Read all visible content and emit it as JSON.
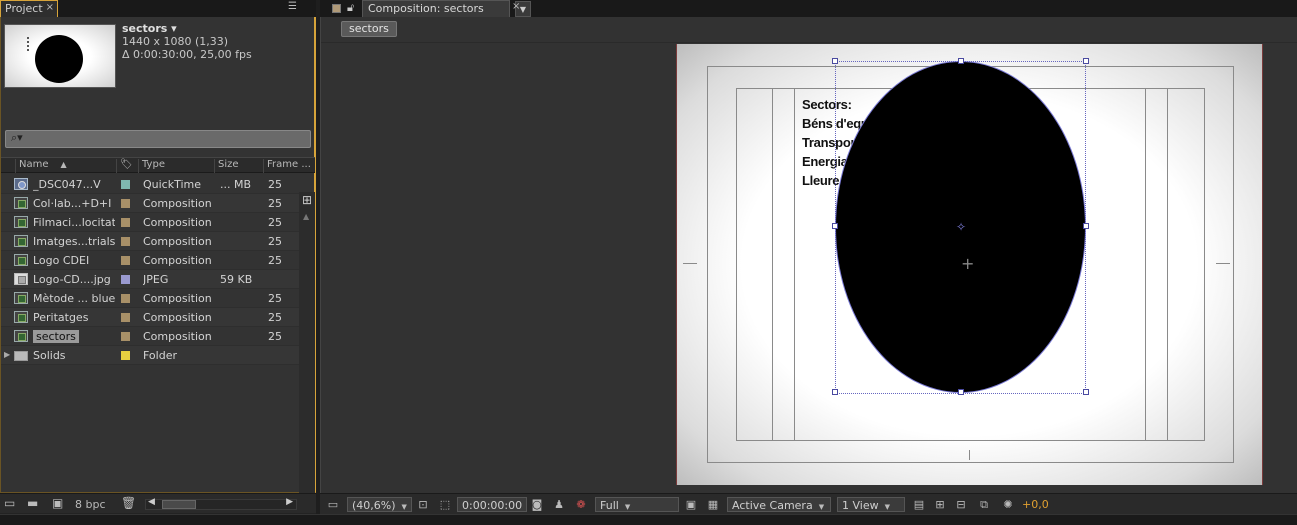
{
  "project_panel": {
    "tab_label": "Project",
    "close_glyph": "×",
    "menu_glyph": "☰",
    "selected_item": {
      "name": "sectors ▾",
      "dimensions": "1440 x 1080 (1,33)",
      "duration": "Δ 0:00:30:00, 25,00 fps"
    },
    "search_placeholder": "",
    "search_icon": "⌕▾",
    "columns": {
      "name": "Name",
      "label": "",
      "type": "Type",
      "size": "Size",
      "frame": "Frame ..."
    },
    "items": [
      {
        "icon": "quicktime",
        "name": "_DSC047...V",
        "label_color": "#7fb8b0",
        "type": "QuickTime",
        "size": "... MB",
        "frame": "25"
      },
      {
        "icon": "composition",
        "name": "Col·lab...+D+I",
        "label_color": "#a89068",
        "type": "Composition",
        "size": "",
        "frame": "25"
      },
      {
        "icon": "composition",
        "name": "Filmaci...locitat",
        "label_color": "#a89068",
        "type": "Composition",
        "size": "",
        "frame": "25"
      },
      {
        "icon": "composition",
        "name": "Imatges...trials",
        "label_color": "#a89068",
        "type": "Composition",
        "size": "",
        "frame": "25"
      },
      {
        "icon": "composition",
        "name": "Logo CDEI",
        "label_color": "#a89068",
        "type": "Composition",
        "size": "",
        "frame": "25"
      },
      {
        "icon": "jpeg",
        "name": "Logo-CD....jpg",
        "label_color": "#9a9ad0",
        "type": "JPEG",
        "size": "59 KB",
        "frame": ""
      },
      {
        "icon": "composition",
        "name": "Mètode ... blue",
        "label_color": "#a89068",
        "type": "Composition",
        "size": "",
        "frame": "25"
      },
      {
        "icon": "composition",
        "name": "Peritatges",
        "label_color": "#a89068",
        "type": "Composition",
        "size": "",
        "frame": "25"
      },
      {
        "icon": "composition",
        "name": "sectors",
        "label_color": "#a89068",
        "type": "Composition",
        "size": "",
        "frame": "25"
      },
      {
        "icon": "folder",
        "name": "Solids",
        "label_color": "#e8d040",
        "type": "Folder",
        "size": "",
        "frame": ""
      }
    ],
    "footer": {
      "bpc": "8 bpc"
    }
  },
  "composition_panel": {
    "tab_label": "Composition: sectors",
    "breadcrumb": "sectors",
    "canvas_text": [
      "Sectors:",
      "Béns d'equ",
      "Transport",
      "Energia",
      "Lleure"
    ],
    "footer": {
      "zoom": "(40,6%)",
      "timecode": "0:00:00:00",
      "resolution": "Full",
      "camera": "Active Camera",
      "views": "1 View",
      "exposure": "+0,0"
    }
  },
  "colors": {
    "accent": "#d7a43a",
    "selection": "#9a9a9a",
    "path": "#7b7bd6"
  }
}
